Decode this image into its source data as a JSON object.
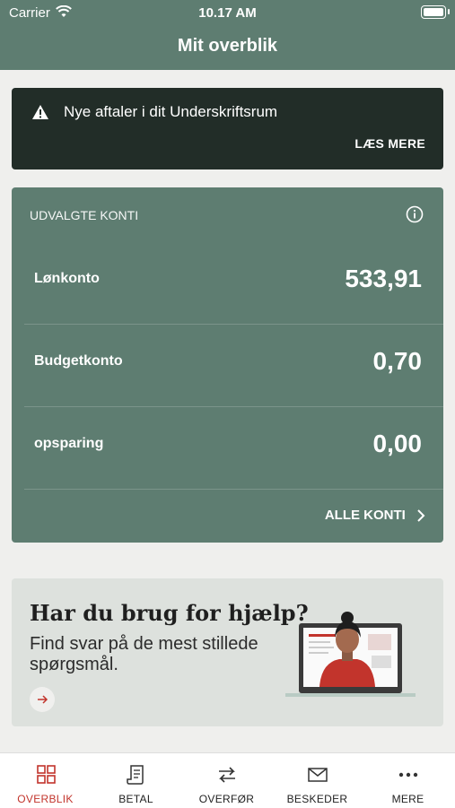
{
  "status": {
    "carrier": "Carrier",
    "time": "10.17 AM"
  },
  "header": {
    "title": "Mit overblik"
  },
  "alert": {
    "text": "Nye aftaler i dit Underskriftsrum",
    "action": "LÆS MERE"
  },
  "accounts": {
    "title": "UDVALGTE KONTI",
    "items": [
      {
        "name": "Lønkonto",
        "amount": "533,91"
      },
      {
        "name": "Budgetkonto",
        "amount": "0,70"
      },
      {
        "name": "opsparing",
        "amount": "0,00"
      }
    ],
    "all_label": "ALLE KONTI"
  },
  "help": {
    "title": "Har du brug for hjælp?",
    "subtitle": "Find svar på de mest stillede spørgsmål."
  },
  "tabs": [
    {
      "label": "OVERBLIK",
      "icon": "grid-icon",
      "active": true
    },
    {
      "label": "BETAL",
      "icon": "bill-icon"
    },
    {
      "label": "OVERFØR",
      "icon": "transfer-icon"
    },
    {
      "label": "BESKEDER",
      "icon": "mail-icon"
    },
    {
      "label": "MERE",
      "icon": "more-icon"
    }
  ],
  "colors": {
    "brand": "#5e7d71",
    "alert_bg": "#222d28",
    "active_tab": "#c2342c"
  }
}
